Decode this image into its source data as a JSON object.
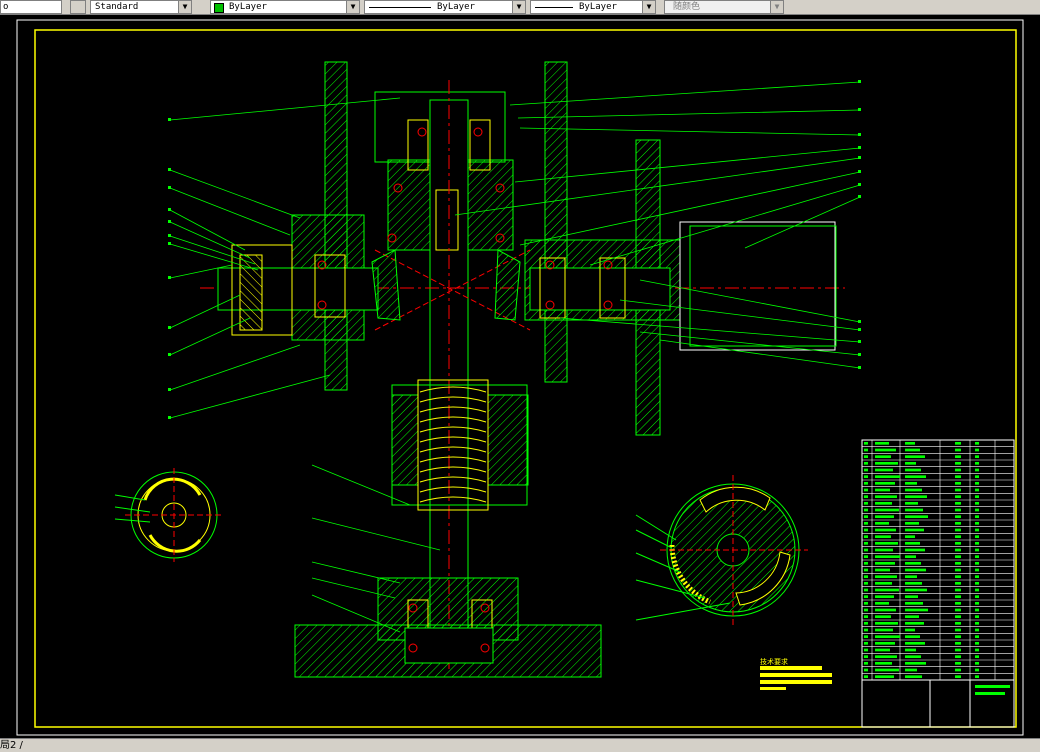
{
  "toolbar": {
    "text_style_value": "Standard",
    "layer_value": "ByLayer",
    "linetype_value": "ByLayer",
    "lineweight_value": "ByLayer",
    "plotstyle_value": "随颜色",
    "color_swatch": "#00c000"
  },
  "drawing": {
    "background": "#000000",
    "frame_color": "#ffff00",
    "geometry_color": "#00ff00",
    "hatch_color": "#ffff00",
    "centerline_color": "#ff0000",
    "bolt_color": "#ff0000"
  },
  "title_block": {
    "tech_note_heading": "技术要求"
  },
  "status": {
    "tab_label": "局2 /"
  }
}
